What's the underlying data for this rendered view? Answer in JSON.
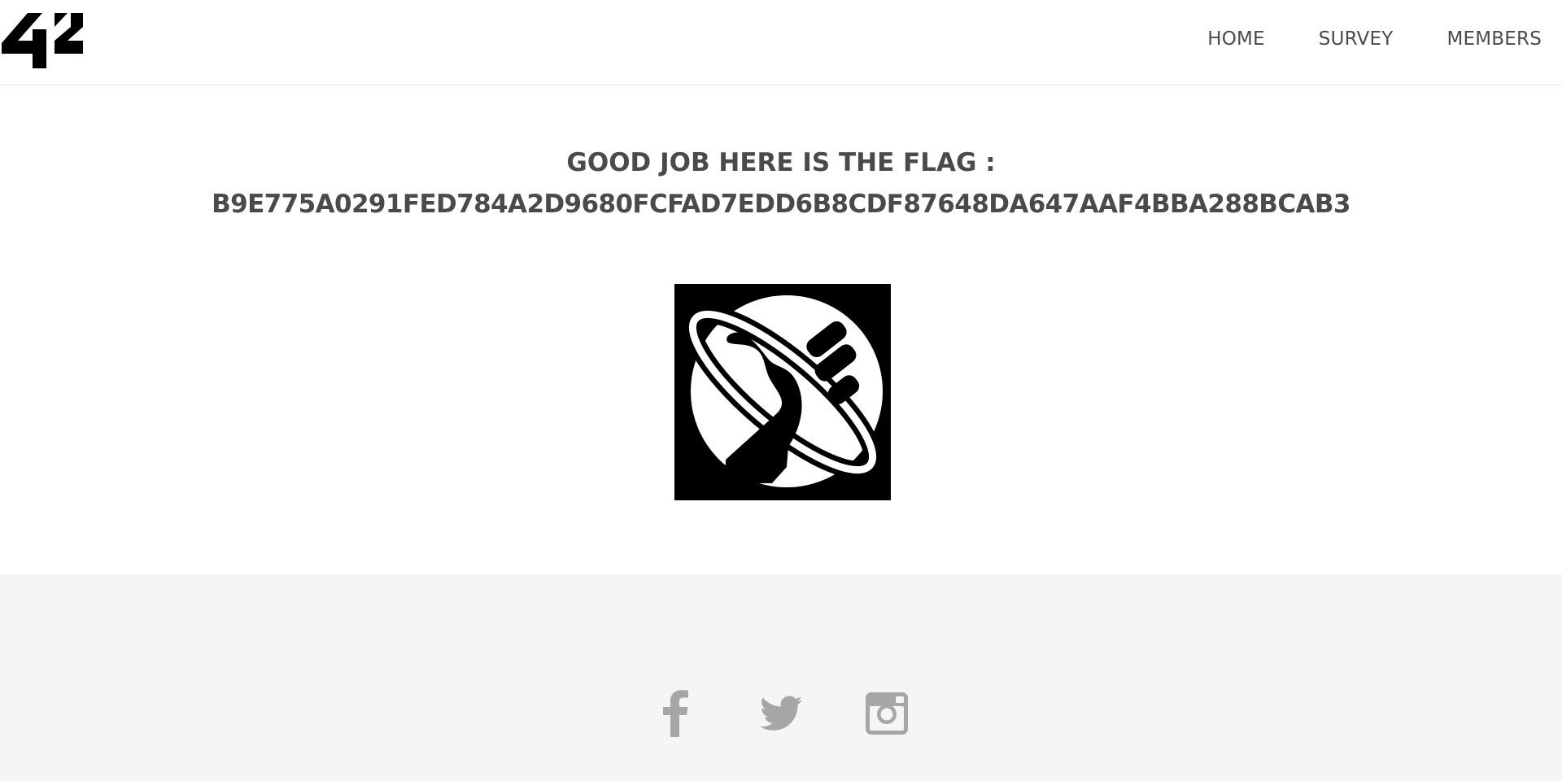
{
  "header": {
    "logo_text": "42",
    "nav": {
      "home": "HOME",
      "survey": "SURVEY",
      "members": "MEMBERS"
    }
  },
  "main": {
    "heading_line1": "GOOD JOB HERE IS THE FLAG :",
    "flag_value": "B9E775A0291FED784A2D9680FCFAD7EDD6B8CDF87648DA647AAF4BBA288BCAB3",
    "image_icon": "thumbs-up-planet-icon"
  },
  "footer": {
    "social": [
      {
        "icon": "facebook-icon"
      },
      {
        "icon": "twitter-icon"
      },
      {
        "icon": "instagram-icon"
      }
    ]
  },
  "colors": {
    "text": "#4a4a4a",
    "footer_bg": "#f5f5f5",
    "social_icon": "#a6a6a6",
    "logo": "#000000"
  }
}
